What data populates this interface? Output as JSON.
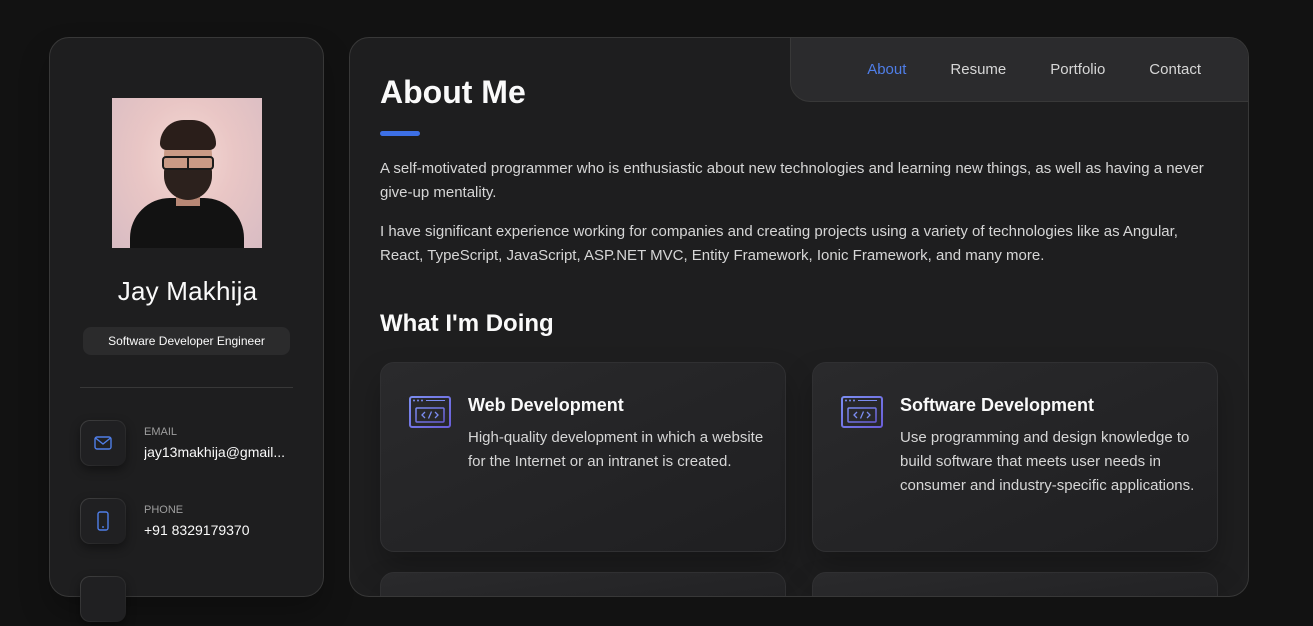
{
  "profile": {
    "name": "Jay Makhija",
    "title": "Software Developer Engineer"
  },
  "contacts": [
    {
      "label": "EMAIL",
      "value": "jay13makhija@gmail...",
      "icon": "mail-icon"
    },
    {
      "label": "PHONE",
      "value": "+91 8329179370",
      "icon": "phone-icon"
    }
  ],
  "nav": {
    "items": [
      "About",
      "Resume",
      "Portfolio",
      "Contact"
    ],
    "active": "About"
  },
  "about": {
    "title": "About Me",
    "paragraphs": [
      "A self-motivated programmer who is enthusiastic about new technologies and learning new things, as well as having a never give-up mentality.",
      "I have significant experience working for companies and creating projects using a variety of technologies like as Angular, React, TypeScript, JavaScript, ASP.NET MVC, Entity Framework, Ionic Framework, and many more."
    ]
  },
  "services": {
    "title": "What I'm Doing",
    "items": [
      {
        "title": "Web Development",
        "description": "High-quality development in which a website for the Internet or an intranet is created.",
        "icon": "code-window-icon"
      },
      {
        "title": "Software Development",
        "description": "Use programming and design knowledge to build software that meets user needs in consumer and industry-specific applications.",
        "icon": "code-window-icon"
      }
    ]
  },
  "colors": {
    "accent": "#4f7ee8",
    "background": "#121212",
    "card": "#1e1e1f"
  }
}
